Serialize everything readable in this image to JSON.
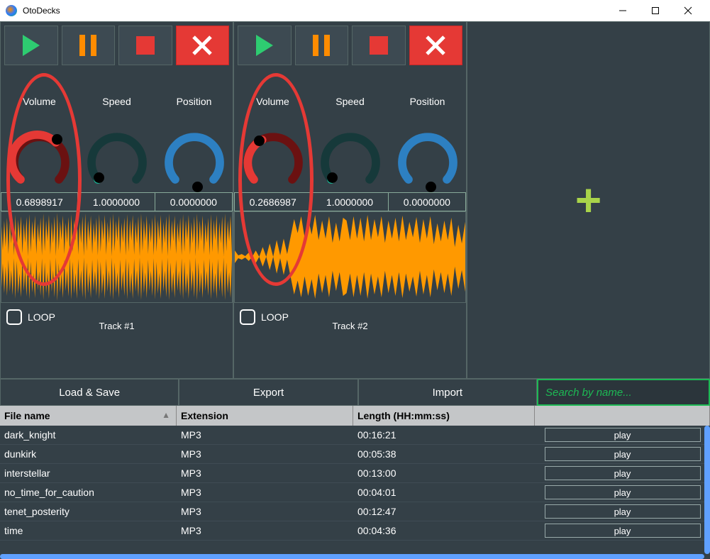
{
  "window": {
    "title": "OtoDecks"
  },
  "decks": [
    {
      "track_title": "Track #1",
      "loop_label": "LOOP",
      "controls": {
        "volume": {
          "label": "Volume",
          "value": "0.6898917"
        },
        "speed": {
          "label": "Speed",
          "value": "1.0000000"
        },
        "position": {
          "label": "Position",
          "value": "0.0000000"
        }
      }
    },
    {
      "track_title": "Track #2",
      "loop_label": "LOOP",
      "controls": {
        "volume": {
          "label": "Volume",
          "value": "0.2686987"
        },
        "speed": {
          "label": "Speed",
          "value": "1.0000000"
        },
        "position": {
          "label": "Position",
          "value": "0.0000000"
        }
      }
    }
  ],
  "toolbar": {
    "load_save": "Load & Save",
    "export": "Export",
    "import": "Import",
    "search_placeholder": "Search by name..."
  },
  "playlist": {
    "columns": {
      "name": "File name",
      "ext": "Extension",
      "len": "Length (HH:mm:ss)"
    },
    "play_label": "play",
    "rows": [
      {
        "name": "dark_knight",
        "ext": "MP3",
        "len": "00:16:21"
      },
      {
        "name": "dunkirk",
        "ext": "MP3",
        "len": "00:05:38"
      },
      {
        "name": "interstellar",
        "ext": "MP3",
        "len": "00:13:00"
      },
      {
        "name": "no_time_for_caution",
        "ext": "MP3",
        "len": "00:04:01"
      },
      {
        "name": "tenet_posterity",
        "ext": "MP3",
        "len": "00:12:47"
      },
      {
        "name": "time",
        "ext": "MP3",
        "len": "00:04:36"
      }
    ]
  }
}
